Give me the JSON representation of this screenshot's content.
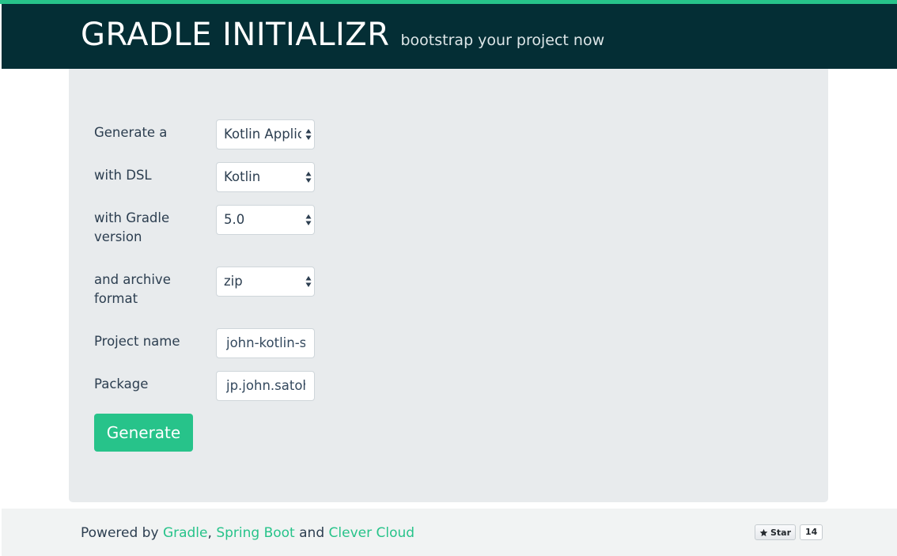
{
  "header": {
    "title": "GRADLE INITIALIZR",
    "tagline": "bootstrap your project now"
  },
  "form": {
    "generate": {
      "label": "Generate a",
      "value": "Kotlin Application"
    },
    "dsl": {
      "label": "with DSL",
      "value": "Kotlin"
    },
    "gradle_version": {
      "label": "with Gradle version",
      "value": "5.0"
    },
    "archive_format": {
      "label": "and archive format",
      "value": "zip"
    },
    "project_name": {
      "label": "Project name",
      "value": "john-kotlin-sample"
    },
    "package": {
      "label": "Package",
      "value": "jp.john.satoh"
    },
    "submit_label": "Generate"
  },
  "footer": {
    "powered_by": "Powered by",
    "link_gradle": "Gradle",
    "comma": ",",
    "link_spring_boot": "Spring Boot",
    "and": "and",
    "link_clever_cloud": "Clever Cloud",
    "star_label": "Star",
    "star_count": "14"
  },
  "colors": {
    "accent": "#27c38a",
    "header_bg": "#042e35",
    "panel_bg": "#e8ebed",
    "footer_bg": "#f1f3f3"
  },
  "icons": [
    "sort-arrows-icon",
    "star-icon"
  ]
}
